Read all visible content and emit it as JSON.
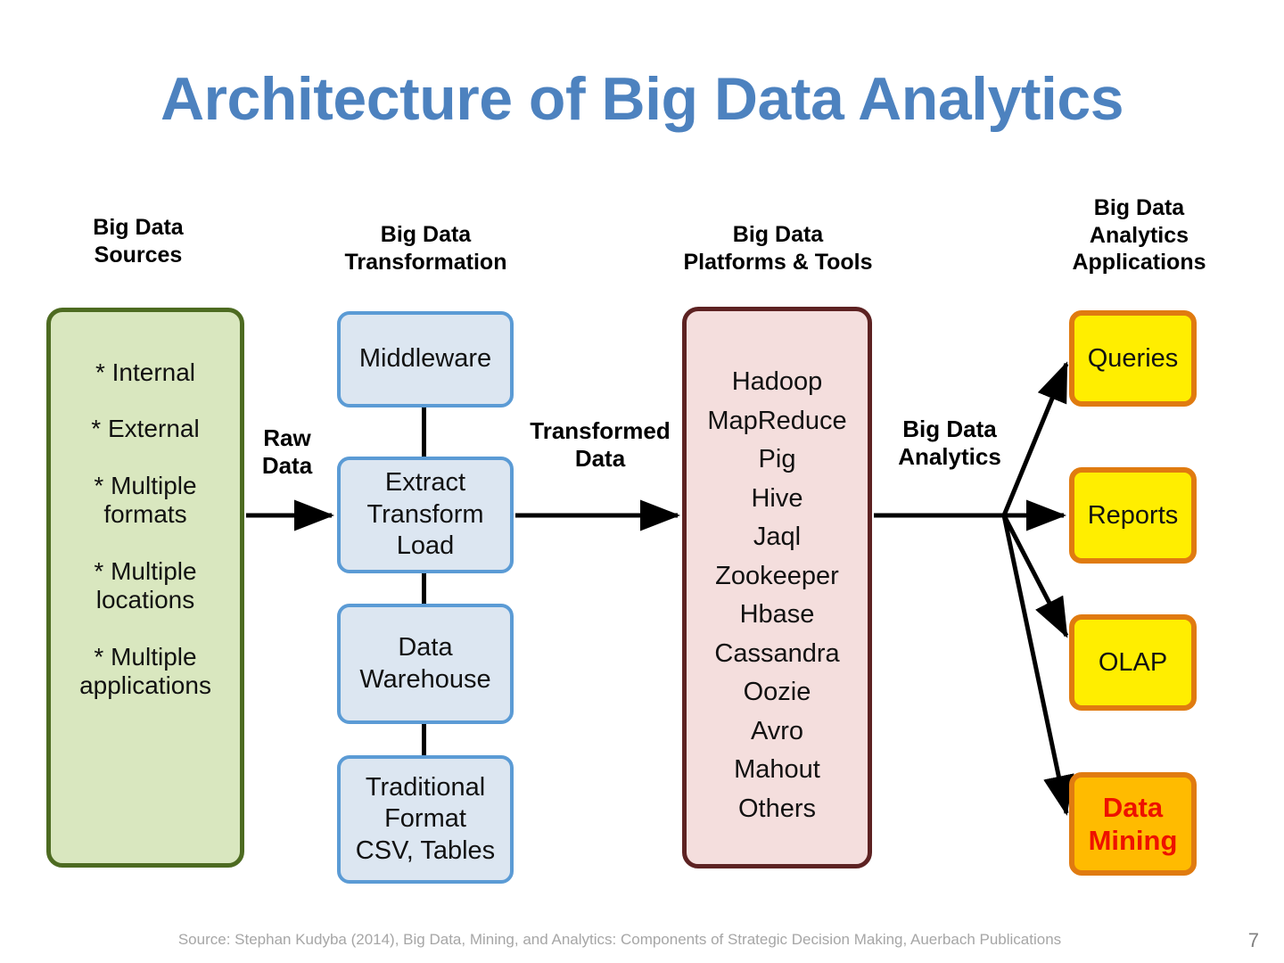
{
  "title": "Architecture of Big Data Analytics",
  "colors": {
    "title_blue": "#4d82bf",
    "sources_fill": "#d9e7bf",
    "sources_border": "#4d6b21",
    "transform_fill": "#dce6f1",
    "transform_border": "#5b9bd5",
    "platforms_fill": "#f4dedd",
    "platforms_border": "#5d2222",
    "apps_fill": "#ffee00",
    "apps_border": "#e07b10",
    "mining_fill": "#ffbb00",
    "mining_text": "#ee1100",
    "arrow": "#000000",
    "footer": "#a6a6a6"
  },
  "columns": {
    "sources": {
      "header": "Big Data\nSources",
      "header_line1": "Big Data",
      "header_line2": "Sources",
      "items": [
        "* Internal",
        "* External",
        "* Multiple\nformats",
        "* Multiple\nlocations",
        "* Multiple\napplications"
      ]
    },
    "transformation": {
      "header_line1": "Big Data",
      "header_line2": "Transformation",
      "boxes": [
        {
          "label": "Middleware"
        },
        {
          "label": "Extract\nTransform\nLoad"
        },
        {
          "label": "Data\nWarehouse"
        },
        {
          "label": "Traditional\nFormat\nCSV, Tables"
        }
      ]
    },
    "platforms": {
      "header_line1": "Big Data",
      "header_line2": "Platforms & Tools",
      "items": [
        "Hadoop",
        "MapReduce",
        "Pig",
        "Hive",
        "Jaql",
        "Zookeeper",
        "Hbase",
        "Cassandra",
        "Oozie",
        "Avro",
        "Mahout",
        "Others"
      ]
    },
    "applications": {
      "header_line1": "Big Data",
      "header_line2": "Analytics",
      "header_line3": "Applications",
      "boxes": [
        {
          "label": "Queries"
        },
        {
          "label": "Reports"
        },
        {
          "label": "OLAP"
        },
        {
          "label": "Data\nMining",
          "highlight": true
        }
      ]
    }
  },
  "flow_labels": {
    "raw_data": "Raw\nData",
    "raw_data_line1": "Raw",
    "raw_data_line2": "Data",
    "transformed_data_line1": "Transformed",
    "transformed_data_line2": "Data",
    "big_data_analytics_line1": "Big Data",
    "big_data_analytics_line2": "Analytics"
  },
  "footer": {
    "source": "Source: Stephan Kudyba (2014), Big Data, Mining, and Analytics: Components of Strategic Decision Making, Auerbach Publications",
    "page_number": "7"
  }
}
